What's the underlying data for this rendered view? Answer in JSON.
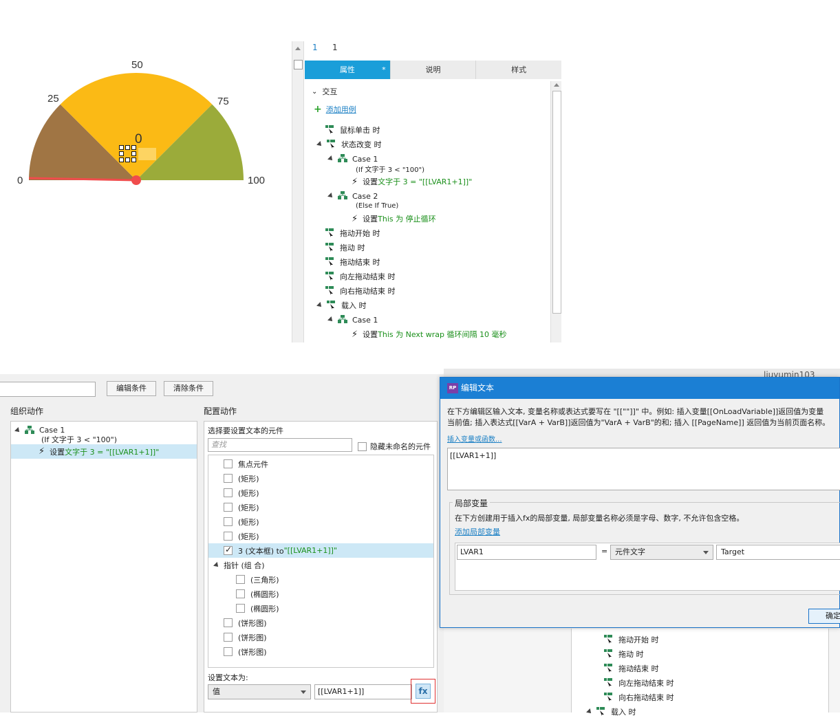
{
  "gauge": {
    "labels": {
      "l0": "0",
      "l25": "25",
      "l50": "50",
      "l75": "75",
      "l100": "100"
    },
    "value_text": "0",
    "needle_value": 0,
    "colors": {
      "low": "#a07544",
      "mid": "#fbba15",
      "high": "#9bab3a",
      "needle": "#f04c4c"
    }
  },
  "top_panel": {
    "ruler": [
      "1",
      "1"
    ],
    "tabs": [
      {
        "label": "属性",
        "star": "*"
      },
      {
        "label": "说明"
      },
      {
        "label": "样式"
      }
    ],
    "section": "交互",
    "add_case": "添加用例",
    "events": [
      {
        "label": "鼠标单击 时"
      },
      {
        "label": "状态改变 时"
      },
      {
        "label": "Case 1"
      },
      {
        "label": "(If 文字于 3 < \"100\")"
      },
      {
        "prefix": "设置 ",
        "text": "文字于 3 = \"[[LVAR1+1]]\""
      },
      {
        "label": "Case 2"
      },
      {
        "label": "(Else If True)"
      },
      {
        "prefix": "设置 ",
        "text": "This 为 停止循环"
      },
      {
        "label": "拖动开始 时"
      },
      {
        "label": "拖动 时"
      },
      {
        "label": "拖动结束 时"
      },
      {
        "label": "向左拖动结束 时"
      },
      {
        "label": "向右拖动结束 时"
      },
      {
        "label": "载入 时"
      },
      {
        "label": "Case 1"
      },
      {
        "prefix": "设置 ",
        "text": "This 为 Next wrap 循环间隔 10 毫秒"
      }
    ]
  },
  "case_editor": {
    "edit_condition": "编辑条件",
    "clear_condition": "清除条件",
    "organize_title": "组织动作",
    "case_label": "Case 1",
    "case_condition": "(If 文字于 3 < \"100\")",
    "action_prefix": "设置 ",
    "action_text": "文字于 3 = \"[[LVAR1+1]]\"",
    "configure_title": "配置动作",
    "select_widget_title": "选择要设置文本的元件",
    "search_placeholder": "查找",
    "hide_unnamed": "隐藏未命名的元件",
    "widgets": [
      {
        "label": "焦点元件",
        "checked": false,
        "indent": 0
      },
      {
        "label": "(矩形)",
        "checked": false,
        "indent": 0
      },
      {
        "label": "(矩形)",
        "checked": false,
        "indent": 0
      },
      {
        "label": "(矩形)",
        "checked": false,
        "indent": 0
      },
      {
        "label": "(矩形)",
        "checked": false,
        "indent": 0
      },
      {
        "label": "(矩形)",
        "checked": false,
        "indent": 0
      },
      {
        "label": "3 (文本框) to ",
        "green": "\"[[LVAR1+1]]\"",
        "checked": true,
        "indent": 0
      },
      {
        "label": "指针 (组 合)",
        "group": true
      },
      {
        "label": "(三角形)",
        "checked": false,
        "indent": 1
      },
      {
        "label": "(椭圆形)",
        "checked": false,
        "indent": 1
      },
      {
        "label": "(椭圆形)",
        "checked": false,
        "indent": 1
      },
      {
        "label": "(饼形图)",
        "checked": false,
        "indent": 0
      },
      {
        "label": "(饼形图)",
        "checked": false,
        "indent": 0
      },
      {
        "label": "(饼形图)",
        "checked": false,
        "indent": 0
      }
    ],
    "set_text_label": "设置文本为:",
    "value_type": "值",
    "value": "[[LVAR1+1]]",
    "fx": "fx"
  },
  "edit_text_dialog": {
    "title": "编辑文本",
    "badge": "RP",
    "instructions_1": "在下方编辑区输入文本, 变量名称或表达式要写在 \"[[\"\"]]\" 中。例如: 插入变量[[OnLoadVariable]]返回值为变量",
    "instructions_2": "当前值; 插入表达式[[VarA + VarB]]返回值为\"VarA + VarB\"的和; 插入 [[PageName]] 返回值为当前页面名称。",
    "insert_link": "插入变量或函数...",
    "editor_text": "[[LVAR1+1]]",
    "local_vars_title": "局部变量",
    "local_vars_desc": "在下方创建用于插入fx的局部变量, 局部变量名称必须是字母、数字, 不允许包含空格。",
    "add_local_var": "添加局部变量",
    "var_name": "LVAR1",
    "equals": "=",
    "var_type": "元件文字",
    "var_target": "Target",
    "ok": "确定"
  },
  "background_events": [
    "拖动开始 时",
    "拖动 时",
    "拖动结束 时",
    "向左拖动结束 时",
    "向右拖动结束 时",
    "载入 时"
  ],
  "background_user": "liuyumin103"
}
